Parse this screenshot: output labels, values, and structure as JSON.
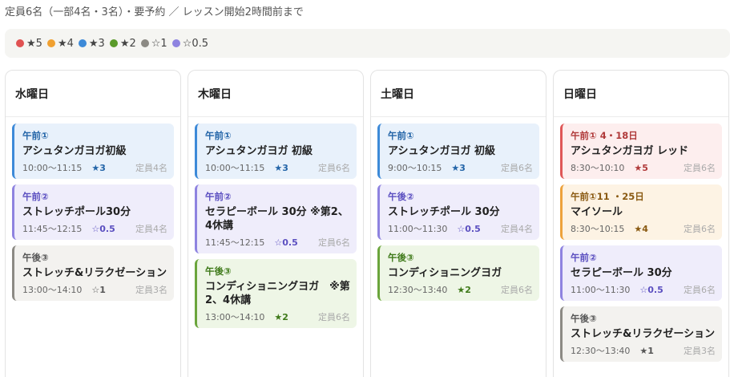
{
  "notice": "定員6名（一部4名・3名）・要予約 ／ レッスン開始2時間前まで",
  "legend": [
    {
      "color": "#e05252",
      "label": "★5"
    },
    {
      "color": "#f0a030",
      "label": "★4"
    },
    {
      "color": "#3d8ad8",
      "label": "★3"
    },
    {
      "color": "#5a9a2a",
      "label": "★2"
    },
    {
      "color": "#8c8a84",
      "label": "☆1"
    },
    {
      "color": "#8e83e0",
      "label": "☆0.5"
    }
  ],
  "days": [
    {
      "name": "水曜日",
      "cards": [
        {
          "color": "blue",
          "period": "午前①",
          "title": "アシュタンガヨガ初級",
          "time": "10:00〜11:15",
          "rating": "★3",
          "capacity": "定員4名"
        },
        {
          "color": "purple",
          "period": "午前②",
          "title": "ストレッチポール30分",
          "time": "11:45〜12:15",
          "rating": "☆0.5",
          "capacity": "定員4名"
        },
        {
          "color": "gray",
          "period": "午後③",
          "title": "ストレッチ&リラクゼーション",
          "time": "13:00〜14:10",
          "rating": "☆1",
          "capacity": "定員3名"
        }
      ]
    },
    {
      "name": "木曜日",
      "cards": [
        {
          "color": "blue",
          "period": "午前①",
          "title": "アシュタンガヨガ 初級",
          "time": "10:00〜11:15",
          "rating": "★3",
          "capacity": "定員6名"
        },
        {
          "color": "purple",
          "period": "午前②",
          "title": "セラピーボール 30分 ※第2、4休講",
          "time": "11:45〜12:15",
          "rating": "☆0.5",
          "capacity": "定員6名"
        },
        {
          "color": "green",
          "period": "午後③",
          "title": "コンディショニングヨガ　※第2、4休講",
          "time": "13:00〜14:10",
          "rating": "★2",
          "capacity": "定員6名"
        }
      ]
    },
    {
      "name": "土曜日",
      "cards": [
        {
          "color": "blue",
          "period": "午前①",
          "title": "アシュタンガヨガ 初級",
          "time": "9:00〜10:15",
          "rating": "★3",
          "capacity": "定員6名"
        },
        {
          "color": "purple",
          "period": "午後②",
          "title": "ストレッチポール 30分",
          "time": "11:00〜11:30",
          "rating": "☆0.5",
          "capacity": "定員4名"
        },
        {
          "color": "green",
          "period": "午後③",
          "title": "コンディショニングヨガ",
          "time": "12:30〜13:40",
          "rating": "★2",
          "capacity": "定員6名"
        }
      ]
    },
    {
      "name": "日曜日",
      "cards": [
        {
          "color": "red",
          "period": "午前① 4・18日",
          "title": "アシュタンガヨガ レッド",
          "time": "8:30〜10:10",
          "rating": "★5",
          "capacity": "定員6名"
        },
        {
          "color": "orange",
          "period": "午前①11 ・25日",
          "title": "マイソール",
          "time": "8:30〜10:15",
          "rating": "★4",
          "capacity": "定員6名"
        },
        {
          "color": "purple",
          "period": "午前②",
          "title": "セラピーボール 30分",
          "time": "11:00〜11:30",
          "rating": "☆0.5",
          "capacity": "定員6名"
        },
        {
          "color": "gray",
          "period": "午後③",
          "title": "ストレッチ&リラクゼーション",
          "time": "12:30〜13:40",
          "rating": "★1",
          "capacity": "定員3名"
        }
      ]
    }
  ]
}
